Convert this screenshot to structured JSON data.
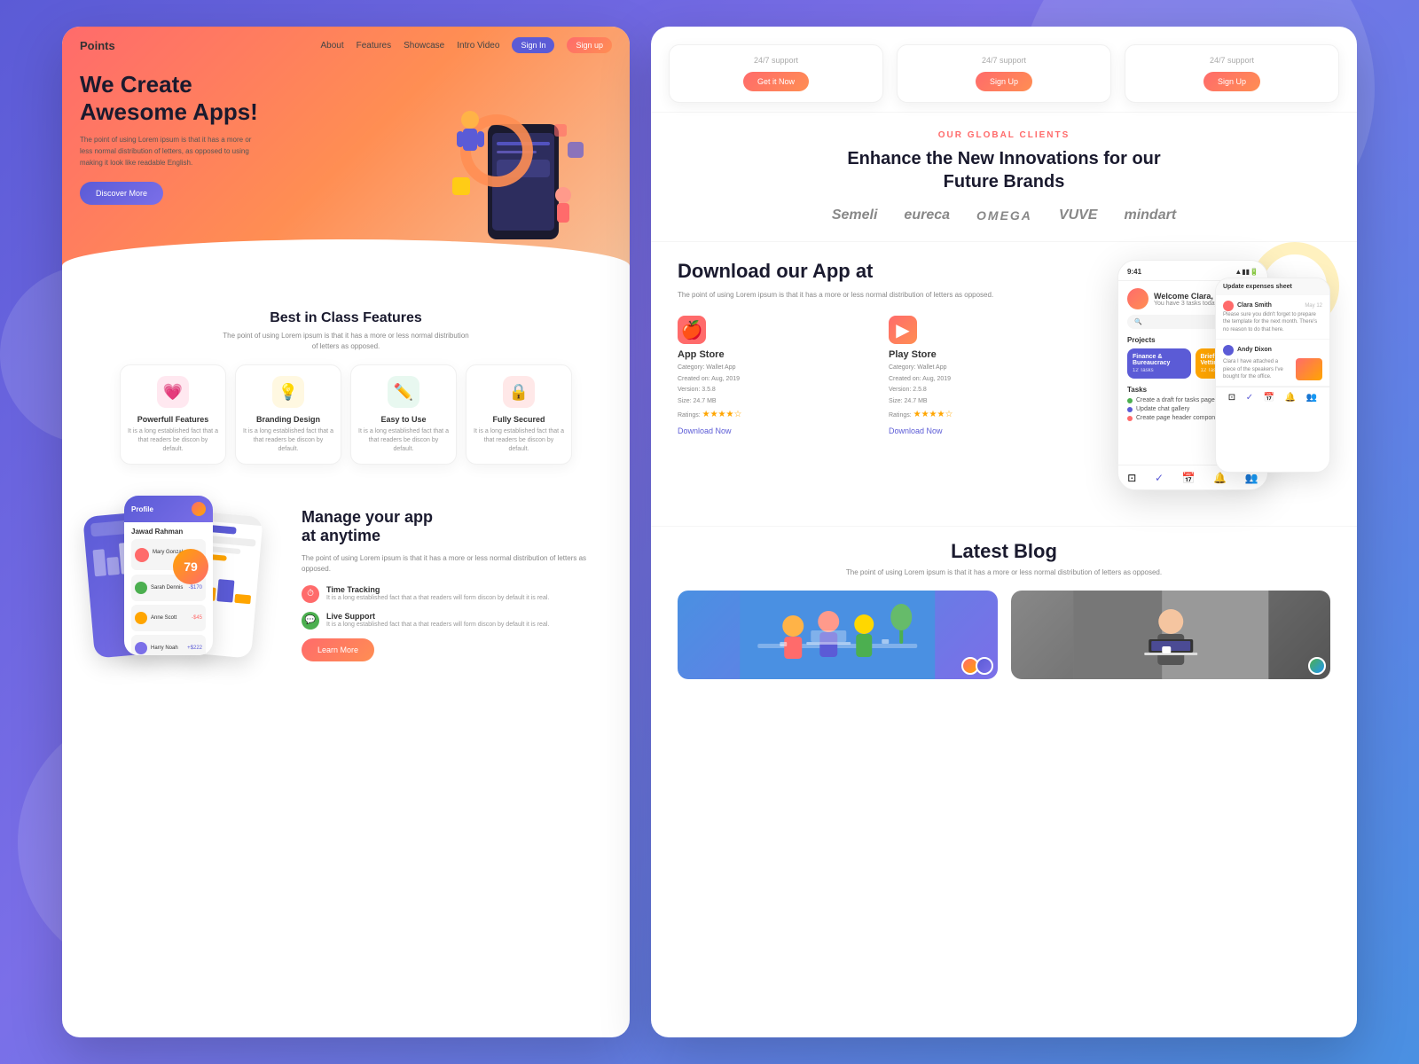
{
  "background": {
    "color": "#6b6bdb"
  },
  "left_panel": {
    "nav": {
      "logo": "Points",
      "links": [
        "About",
        "Features",
        "Showcase",
        "Intro Video"
      ],
      "signin_label": "Sign In",
      "signup_label": "Sign up"
    },
    "hero": {
      "title_line1": "We Create",
      "title_line2": "Awesome Apps!",
      "description": "The point of using Lorem ipsum is that it has a more or less normal distribution of letters, as opposed to using making it look like readable English.",
      "cta_label": "Discover More"
    },
    "features": {
      "section_title": "Best in Class Features",
      "section_desc": "The point of using Lorem ipsum is that it has a more or less normal distribution of letters as opposed.",
      "cards": [
        {
          "icon": "💗",
          "icon_class": "feature-icon-pink",
          "name": "Powerfull Features",
          "text": "It is a long established fact that a that readers be discon by default."
        },
        {
          "icon": "💡",
          "icon_class": "feature-icon-yellow",
          "name": "Branding Design",
          "text": "It is a long established fact that a that readers be discon by default."
        },
        {
          "icon": "✏️",
          "icon_class": "feature-icon-green",
          "name": "Easy to Use",
          "text": "It is a long established fact that a that readers be discon by default."
        },
        {
          "icon": "🔒",
          "icon_class": "feature-icon-red",
          "name": "Fully Secured",
          "text": "It is a long established fact that a that readers be discon by default."
        }
      ]
    },
    "app_section": {
      "title_line1": "Manage your app",
      "title_line2": "at anytime",
      "description": "The point of using Lorem ipsum is that it has a more or less normal distribution of letters as opposed.",
      "features": [
        {
          "name": "Time Tracking",
          "text": "It is a long established fact that a that readers will form discon by default it is real."
        },
        {
          "name": "Live Support",
          "text": "It is a long established fact that a that readers will form discon by default it is real."
        }
      ],
      "cta_label": "Learn More"
    }
  },
  "right_panel": {
    "pricing_cards": [
      {
        "support": "24/7 support",
        "btn_label": "Get it Now"
      },
      {
        "support": "24/7 support",
        "btn_label": "Sign Up"
      },
      {
        "support": "24/7 support",
        "btn_label": "Sign Up"
      }
    ],
    "clients": {
      "label": "OUR GLOBAL CLIENTS",
      "title_line1": "Enhance the New Innovations for our",
      "title_line2": "Future Brands",
      "logos": [
        "Semeli",
        "eureca",
        "OMEGA",
        "VUVE",
        "mindart"
      ]
    },
    "app_download": {
      "title_line1": "Download our App at",
      "description": "The point of using Lorem ipsum is that it has a more or less normal distribution of letters as opposed.",
      "stores": [
        {
          "name": "App Store",
          "icon": "🍎",
          "icon_class": "store-icon-app",
          "category": "Wallet App",
          "created": "Aug, 2019",
          "version": "3.5.8",
          "size": "24.7 MB",
          "ratings": "★★★★☆",
          "link": "Download Now"
        },
        {
          "name": "Play Store",
          "icon": "▶",
          "icon_class": "store-icon-play",
          "category": "Wallet App",
          "created": "Aug, 2019",
          "version": "2.5.8",
          "size": "24.7 MB",
          "ratings": "★★★★☆",
          "link": "Download Now"
        }
      ]
    },
    "app_ui": {
      "time": "9:41",
      "welcome_name": "Clara,",
      "welcome_text": "Welcome Clara,",
      "tasks_today": "You have 3 tasks today",
      "search_placeholder": "🔍",
      "projects_label": "Projects",
      "projects": [
        {
          "name": "Finance &\nBureaucracy",
          "tasks": "12 Tasks",
          "color": "blue"
        },
        {
          "name": "Briefing &\nVetting",
          "tasks": "12 Tasks",
          "color": "yellow"
        }
      ],
      "tasks_label": "Tasks",
      "tasks": [
        "Create a draft for tasks page",
        "Update chat gallery",
        "Create page header component"
      ]
    },
    "notification_panel": {
      "title": "Update expenses sheet",
      "items": [
        {
          "sender": "Clara Smith",
          "time": "May 12",
          "text": "Please sure you didn't forget to prepare the template for the next month. There's no reason to do that here."
        },
        {
          "sender": "Andy Dixon",
          "time": "",
          "text": "Clara I have attached a piece of the speakers I've bought for the office."
        }
      ]
    },
    "blog": {
      "title": "Latest Blog",
      "description": "The point of using Lorem ipsum is that it has a more or less normal distribution of letters as opposed.",
      "images": [
        {
          "alt": "Team working together"
        },
        {
          "alt": "Person with laptop"
        }
      ]
    }
  }
}
